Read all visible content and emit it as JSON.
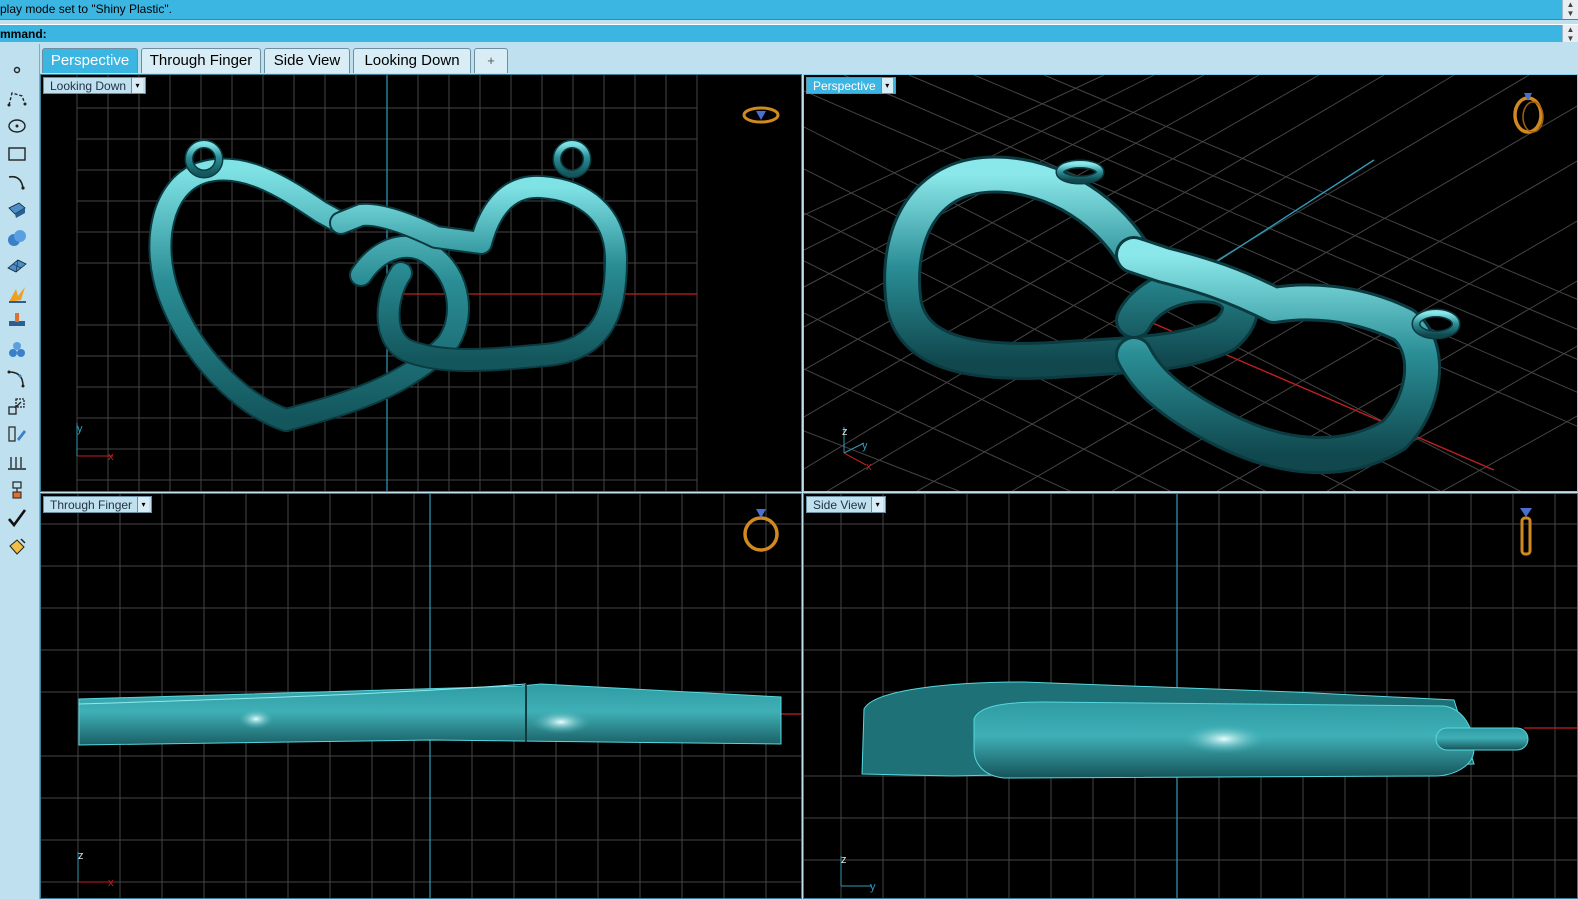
{
  "command_history": {
    "text": "play mode set to \"Shiny Plastic\"."
  },
  "command_prompt": {
    "label": "mmand:"
  },
  "tabs": [
    {
      "label": "Perspective",
      "active": true
    },
    {
      "label": "Through Finger",
      "active": false
    },
    {
      "label": "Side View",
      "active": false
    },
    {
      "label": "Looking Down",
      "active": false
    },
    {
      "label": "+",
      "active": false
    }
  ],
  "toolbar": {
    "tools": [
      {
        "name": "point-icon"
      },
      {
        "name": "polyline-icon"
      },
      {
        "name": "circle-icon"
      },
      {
        "name": "rectangle-icon"
      },
      {
        "name": "curve-icon"
      },
      {
        "name": "surface-icon"
      },
      {
        "name": "solid-spheres-icon"
      },
      {
        "name": "mesh-plane-icon"
      },
      {
        "name": "light-burst-icon"
      },
      {
        "name": "dimension-icon"
      },
      {
        "name": "group-spheres-icon"
      },
      {
        "name": "bend-icon"
      },
      {
        "name": "scale-icon"
      },
      {
        "name": "ruler-edit-icon"
      },
      {
        "name": "array-icon"
      },
      {
        "name": "gumball-icon"
      },
      {
        "name": "checkmark-icon"
      },
      {
        "name": "render-bucket-icon"
      }
    ]
  },
  "viewports": {
    "looking_down": {
      "label": "Looking Down",
      "dropdown": "▾",
      "axis_y": "y",
      "axis_x": "x",
      "nav_icon": "ring-top-icon"
    },
    "perspective": {
      "label": "Perspective",
      "dropdown": "▾",
      "axis_z": "z",
      "axis_y": "y",
      "axis_x": "x",
      "nav_icon": "ring-3d-icon"
    },
    "through_finger": {
      "label": "Through Finger",
      "dropdown": "▾",
      "axis_z": "z",
      "axis_x": "x",
      "nav_icon": "ring-front-icon"
    },
    "side_view": {
      "label": "Side View",
      "dropdown": "▾",
      "axis_z": "z",
      "axis_y": "y",
      "nav_icon": "ring-side-icon"
    }
  },
  "colors": {
    "model": "#2a8d95",
    "model_highlight": "#7fe3e6",
    "grid": "#4a4a4a",
    "grid_major": "#6a6a6a",
    "axis_x": "#c02020",
    "axis_y": "#2f9bb8",
    "ui_accent": "#3bb6e2"
  }
}
